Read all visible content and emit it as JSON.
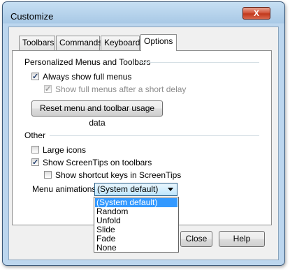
{
  "window": {
    "title": "Customize",
    "close_glyph": "X"
  },
  "tabs": [
    {
      "label": "Toolbars"
    },
    {
      "label": "Commands"
    },
    {
      "label": "Keyboard"
    },
    {
      "label": "Options"
    }
  ],
  "active_tab": "Options",
  "personalized": {
    "heading": "Personalized Menus and Toolbars",
    "always_show_full_menus": {
      "label": "Always show full menus",
      "checked": true
    },
    "show_full_menus_after_delay": {
      "label": "Show full menus after a short delay",
      "checked": true,
      "enabled": false
    },
    "reset_button": "Reset menu and toolbar usage data"
  },
  "other": {
    "heading": "Other",
    "large_icons": {
      "label": "Large icons",
      "checked": false
    },
    "show_screentips": {
      "label": "Show ScreenTips on toolbars",
      "checked": true
    },
    "show_shortcut_keys": {
      "label": "Show shortcut keys in ScreenTips",
      "checked": false
    },
    "menu_animations": {
      "label": "Menu animations:",
      "value": "(System default)",
      "options": [
        "(System default)",
        "Random",
        "Unfold",
        "Slide",
        "Fade",
        "None"
      ],
      "selected_index": 0
    }
  },
  "footer": {
    "close_button": "Close",
    "help_button": "Help"
  },
  "colors": {
    "selection": "#3399ff",
    "title_bar": "#bcd6ee",
    "close_button": "#c1391e"
  }
}
